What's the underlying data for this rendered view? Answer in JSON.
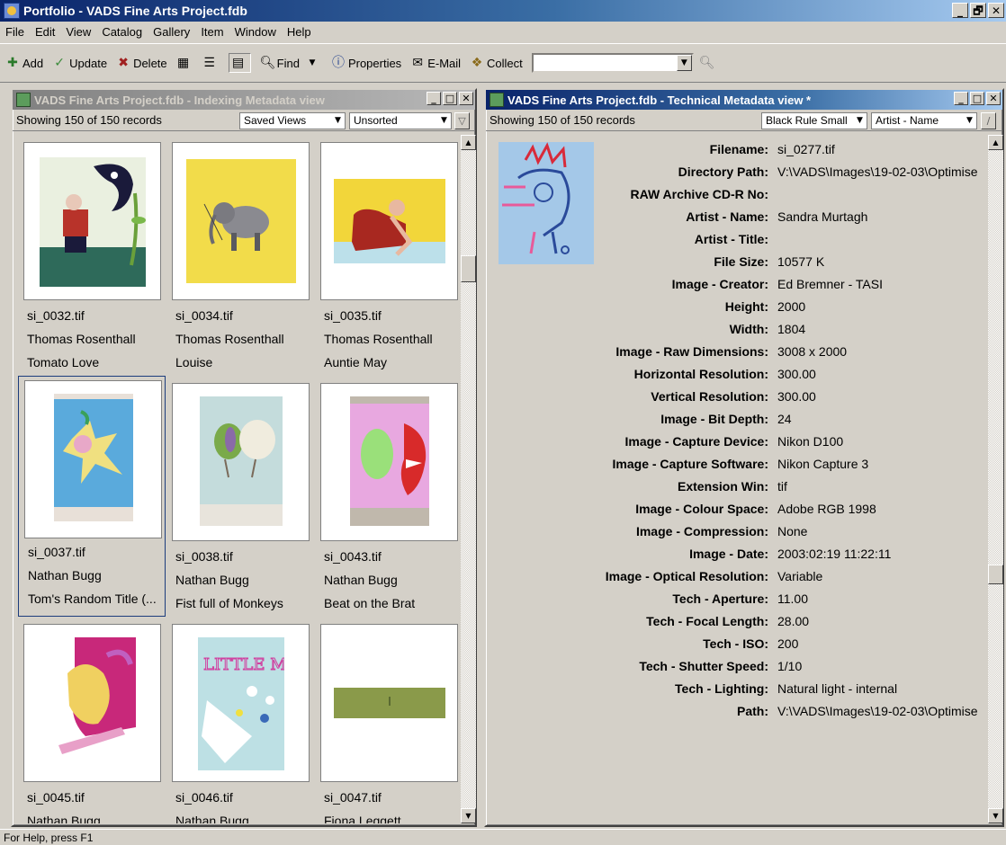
{
  "window": {
    "title": "Portfolio - VADS Fine Arts Project.fdb",
    "min": "_",
    "max": "🗗",
    "close": "✕"
  },
  "menu": [
    "File",
    "Edit",
    "View",
    "Catalog",
    "Gallery",
    "Item",
    "Window",
    "Help"
  ],
  "toolbar": {
    "add": "Add",
    "update": "Update",
    "delete": "Delete",
    "find": "Find",
    "properties": "Properties",
    "email": "E-Mail",
    "collect": "Collect",
    "search_value": ""
  },
  "left_view": {
    "title": "VADS Fine Arts Project.fdb - Indexing Metadata view",
    "count": "Showing 150 of 150 records",
    "saved_views": "Saved Views",
    "sort": "Unsorted",
    "items": [
      {
        "file": "si_0032.tif",
        "artist": "Thomas Rosenthall",
        "title": "Tomato Love"
      },
      {
        "file": "si_0034.tif",
        "artist": "Thomas Rosenthall",
        "title": "Louise"
      },
      {
        "file": "si_0035.tif",
        "artist": "Thomas Rosenthall",
        "title": "Auntie May"
      },
      {
        "file": "si_0037.tif",
        "artist": "Nathan Bugg",
        "title": "Tom's Random Title (..."
      },
      {
        "file": "si_0038.tif",
        "artist": "Nathan Bugg",
        "title": "Fist full of Monkeys"
      },
      {
        "file": "si_0043.tif",
        "artist": "Nathan Bugg",
        "title": "Beat on the Brat"
      },
      {
        "file": "si_0045.tif",
        "artist": "Nathan Bugg",
        "title": ""
      },
      {
        "file": "si_0046.tif",
        "artist": "Nathan Bugg",
        "title": ""
      },
      {
        "file": "si_0047.tif",
        "artist": "Fiona Leggett",
        "title": ""
      }
    ],
    "art_text": {
      "item_7": "LITTLE MISS"
    }
  },
  "right_view": {
    "title": "VADS Fine Arts Project.fdb - Technical Metadata view *",
    "count": "Showing 150 of 150 records",
    "template": "Black Rule Small",
    "sort": "Artist - Name",
    "fields": [
      {
        "label": "Filename:",
        "value": "si_0277.tif"
      },
      {
        "label": "Directory Path:",
        "value": "V:\\VADS\\Images\\19-02-03\\Optimise"
      },
      {
        "label": "RAW Archive CD-R No:",
        "value": ""
      },
      {
        "label": "Artist - Name:",
        "value": "Sandra Murtagh"
      },
      {
        "label": "Artist - Title:",
        "value": ""
      },
      {
        "label": "File Size:",
        "value": "10577 K"
      },
      {
        "label": "Image - Creator:",
        "value": "Ed Bremner - TASI"
      },
      {
        "label": "Height:",
        "value": "2000"
      },
      {
        "label": "Width:",
        "value": "1804"
      },
      {
        "label": "Image - Raw Dimensions:",
        "value": "3008 x 2000"
      },
      {
        "label": "Horizontal Resolution:",
        "value": "300.00"
      },
      {
        "label": "Vertical Resolution:",
        "value": "300.00"
      },
      {
        "label": "Image - Bit Depth:",
        "value": "24"
      },
      {
        "label": "Image - Capture Device:",
        "value": "Nikon D100"
      },
      {
        "label": "Image - Capture Software:",
        "value": "Nikon Capture 3"
      },
      {
        "label": "Extension Win:",
        "value": "tif"
      },
      {
        "label": "Image - Colour Space:",
        "value": "Adobe RGB 1998"
      },
      {
        "label": "Image - Compression:",
        "value": "None"
      },
      {
        "label": "Image - Date:",
        "value": "2003:02:19 11:22:11"
      },
      {
        "label": "Image - Optical Resolution:",
        "value": "Variable"
      },
      {
        "label": "Tech - Aperture:",
        "value": "11.00"
      },
      {
        "label": "Tech - Focal Length:",
        "value": "28.00"
      },
      {
        "label": "Tech - ISO:",
        "value": "200"
      },
      {
        "label": "Tech - Shutter Speed:",
        "value": "1/10"
      },
      {
        "label": "Tech - Lighting:",
        "value": "Natural light - internal"
      },
      {
        "label": "Path:",
        "value": "V:\\VADS\\Images\\19-02-03\\Optimise"
      }
    ]
  },
  "status": "For Help, press F1"
}
